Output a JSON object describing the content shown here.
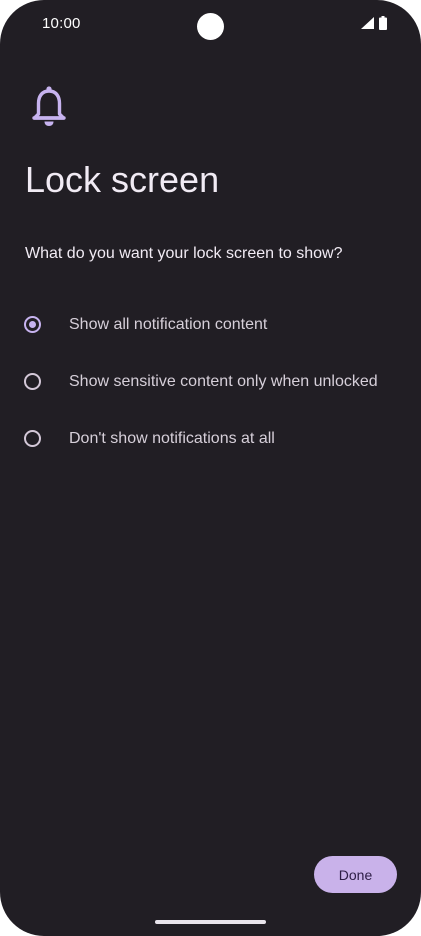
{
  "status_bar": {
    "time": "10:00",
    "icons": [
      "signal-icon",
      "battery-icon"
    ]
  },
  "header": {
    "icon": "bell-icon",
    "title": "Lock screen"
  },
  "content": {
    "question": "What do you want your lock screen to show?",
    "options": [
      {
        "label": "Show all notification content",
        "selected": true
      },
      {
        "label": "Show sensitive content only when unlocked",
        "selected": false
      },
      {
        "label": "Don't show notifications at all",
        "selected": false
      }
    ]
  },
  "footer": {
    "done_label": "Done"
  },
  "colors": {
    "background": "#211e24",
    "accent": "#c7b3ef",
    "button": "#c9b2ea",
    "text": "#f1ebf4"
  }
}
